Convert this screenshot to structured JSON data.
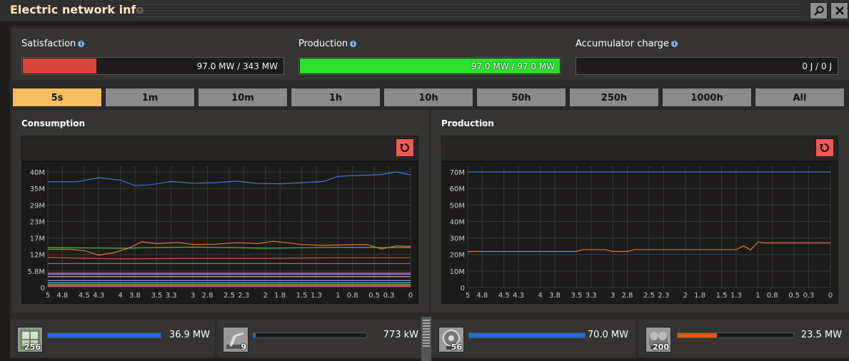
{
  "window": {
    "title": "Electric network info",
    "search_icon": "search-icon",
    "close_icon": "close-icon"
  },
  "top": {
    "satisfaction": {
      "label": "Satisfaction",
      "value": "97.0 MW / 343 MW",
      "fill_fraction": 0.283,
      "color": "#d9433a"
    },
    "production": {
      "label": "Production",
      "value": "97.0 MW / 97.0 MW",
      "fill_fraction": 1.0,
      "color": "#2ee02e"
    },
    "accumulator": {
      "label": "Accumulator charge",
      "value": "0 J / 0 J",
      "fill_fraction": 0
    }
  },
  "tabs": [
    "5s",
    "1m",
    "10m",
    "1h",
    "10h",
    "50h",
    "250h",
    "1000h",
    "All"
  ],
  "active_tab": "5s",
  "chart_data": [
    {
      "type": "line",
      "title": "Consumption",
      "x_ticks": [
        "5",
        "4.8",
        "4.5",
        "4.3",
        "4",
        "3.8",
        "3.5",
        "3.3",
        "3",
        "2.8",
        "2.5",
        "2.3",
        "2",
        "1.8",
        "1.5",
        "1.3",
        "1",
        "0.8",
        "0.5",
        "0.3",
        "0"
      ],
      "y_ticks": [
        "40M",
        "35M",
        "29M",
        "23M",
        "17M",
        "12M",
        "5.8M",
        "0"
      ],
      "ylim": [
        0,
        41000000
      ],
      "grid": true,
      "series": [
        {
          "color": "#3b79e8",
          "x": [
            5,
            4.6,
            4.3,
            4.0,
            3.8,
            3.6,
            3.3,
            3.0,
            2.7,
            2.4,
            2.1,
            1.8,
            1.5,
            1.2,
            1.0,
            0.7,
            0.4,
            0.2,
            0
          ],
          "y": [
            36600000,
            36600000,
            38000000,
            37200000,
            35300000,
            35500000,
            36700000,
            36100000,
            36300000,
            36800000,
            36000000,
            35900000,
            36300000,
            36700000,
            38500000,
            38800000,
            39100000,
            40000000,
            39000000
          ]
        },
        {
          "color": "#e8762a",
          "x": [
            5,
            4.7,
            4.5,
            4.3,
            4.1,
            3.9,
            3.7,
            3.5,
            3.2,
            3.0,
            2.7,
            2.4,
            2.1,
            1.9,
            1.7,
            1.5,
            1.2,
            0.9,
            0.6,
            0.4,
            0.2,
            0
          ],
          "y": [
            13200000,
            13200000,
            12800000,
            11200000,
            12000000,
            13500000,
            15800000,
            15200000,
            15600000,
            14900000,
            15000000,
            15500000,
            15200000,
            16000000,
            15500000,
            14900000,
            14600000,
            14800000,
            14900000,
            13300000,
            14400000,
            14200000
          ]
        },
        {
          "color": "#4fc04f",
          "x": [
            5,
            4,
            3,
            2,
            1,
            0
          ],
          "y": [
            13800000,
            13600000,
            14000000,
            13600000,
            13900000,
            13800000
          ]
        },
        {
          "color": "#e04a3a",
          "x": [
            5,
            4,
            3,
            2,
            1,
            0
          ],
          "y": [
            10400000,
            9900000,
            10100000,
            10100000,
            10300000,
            10300000
          ]
        },
        {
          "color": "#d05060",
          "x": [
            5,
            0
          ],
          "y": [
            8300000,
            8300000
          ]
        },
        {
          "color": "#c060c0",
          "x": [
            5,
            0
          ],
          "y": [
            5000000,
            5000000
          ]
        },
        {
          "color": "#7aa0ff",
          "x": [
            5,
            0
          ],
          "y": [
            4600000,
            4600000
          ]
        },
        {
          "color": "#e0a0a0",
          "x": [
            5,
            0
          ],
          "y": [
            3800000,
            3800000
          ]
        },
        {
          "color": "#a0a0ff",
          "x": [
            5,
            0
          ],
          "y": [
            2400000,
            2400000
          ]
        },
        {
          "color": "#60d0d0",
          "x": [
            5,
            0
          ],
          "y": [
            1600000,
            1600000
          ]
        },
        {
          "color": "#d0d070",
          "x": [
            5,
            0
          ],
          "y": [
            900000,
            900000
          ]
        },
        {
          "color": "#e07070",
          "x": [
            5,
            0
          ],
          "y": [
            400000,
            400000
          ]
        }
      ]
    },
    {
      "type": "line",
      "title": "Production",
      "x_ticks": [
        "5",
        "4.8",
        "4.5",
        "4.3",
        "4",
        "3.8",
        "3.5",
        "3.3",
        "3",
        "2.8",
        "2.5",
        "2.3",
        "2",
        "1.8",
        "1.5",
        "1.3",
        "1",
        "0.8",
        "0.5",
        "0.3",
        "0"
      ],
      "y_ticks": [
        "70M",
        "60M",
        "50M",
        "40M",
        "30M",
        "20M",
        "10M",
        "0"
      ],
      "ylim": [
        0,
        72000000
      ],
      "grid": true,
      "series": [
        {
          "color": "#3b6fe8",
          "x": [
            5,
            0
          ],
          "y": [
            70000000,
            70000000
          ]
        },
        {
          "color": "#e8762a",
          "x": [
            5,
            3.5,
            3.4,
            3.1,
            3.0,
            2.8,
            2.7,
            1.3,
            1.2,
            1.1,
            1.0,
            0.9,
            0
          ],
          "y": [
            21800000,
            21800000,
            23000000,
            23000000,
            21800000,
            21800000,
            23000000,
            23000000,
            25200000,
            22800000,
            27500000,
            27000000,
            27000000
          ]
        }
      ]
    }
  ],
  "reset_icon": "reset-icon",
  "bottom": [
    {
      "icon": "electric-furnace-icon",
      "count": "256",
      "value": "36.9 MW",
      "fill_fraction": 1.0,
      "bar_color": "#1f6be0"
    },
    {
      "icon": "inserter-icon",
      "count": "9",
      "value": "773 kW",
      "fill_fraction": 0.02,
      "bar_color": "#1f6be0"
    },
    {
      "icon": "steam-turbine-icon",
      "count": "56",
      "value": "70.0 MW",
      "fill_fraction": 1.0,
      "bar_color": "#1f6be0"
    },
    {
      "icon": "steam-engine-icon",
      "count": "200",
      "value": "23.5 MW",
      "fill_fraction": 0.34,
      "bar_color": "#e05a10"
    }
  ]
}
